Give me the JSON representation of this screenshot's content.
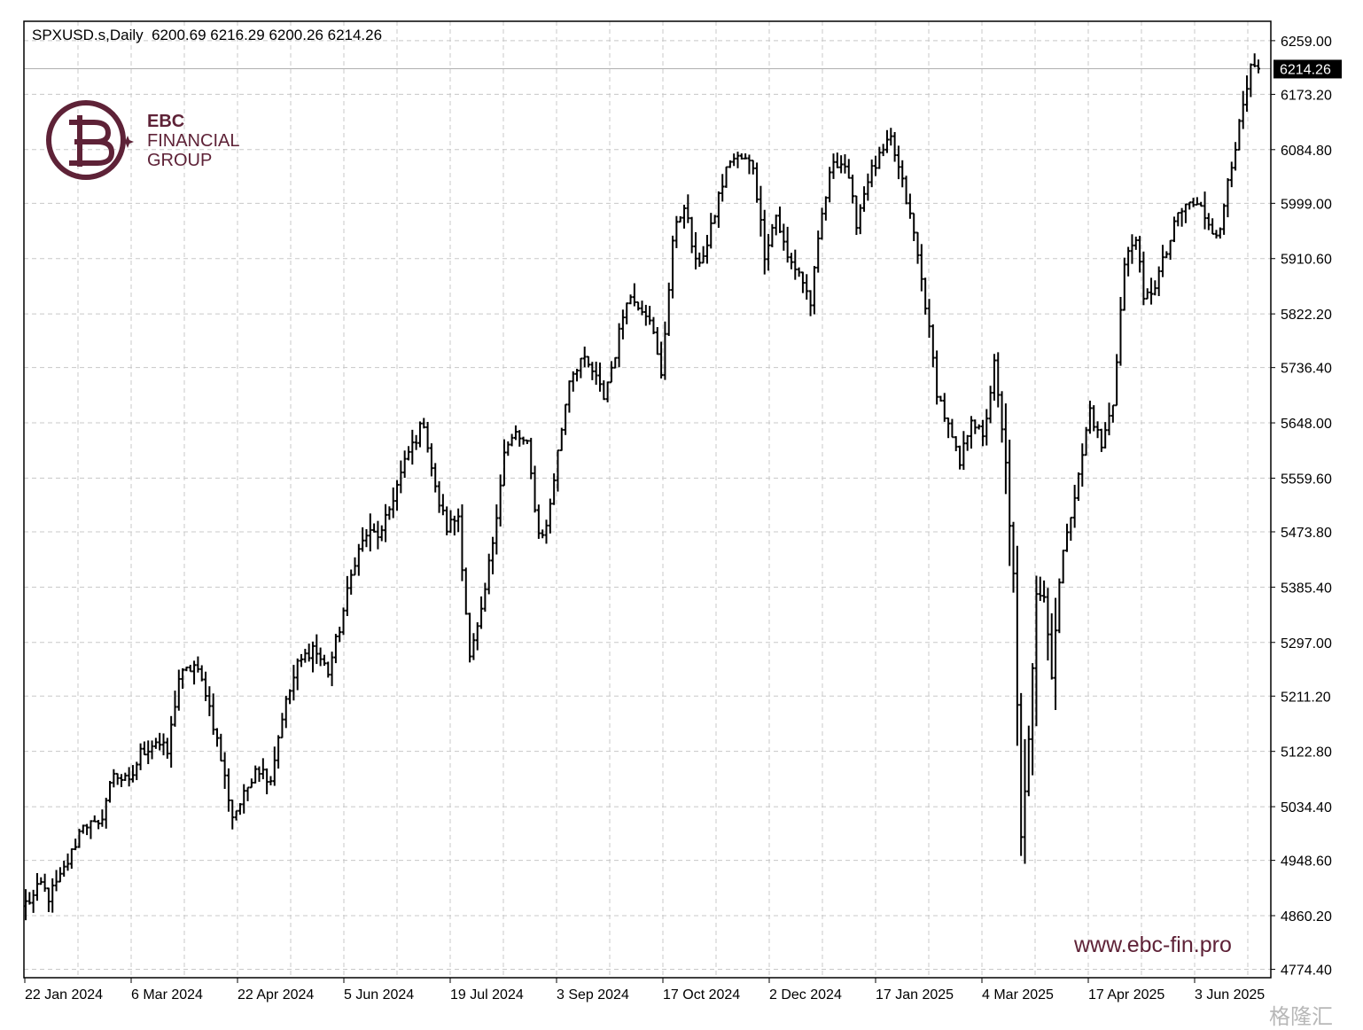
{
  "header": {
    "symbol": "SPXUSD.s,Daily",
    "ohlc": "6200.69 6216.29 6200.26 6214.26"
  },
  "brand": {
    "name_line1": "EBC",
    "name_line2": "FINANCIAL",
    "name_line3": "GROUP",
    "url": "www.ebc-fin.pro",
    "color": "#5e2237",
    "watermark": "格隆汇"
  },
  "chart_data": {
    "type": "bar",
    "subtype": "ohlc",
    "price_axis": {
      "position": "right",
      "ticks": [
        6259.0,
        6173.2,
        6084.8,
        5999.0,
        5910.6,
        5822.2,
        5736.4,
        5648.0,
        5559.6,
        5473.8,
        5385.4,
        5297.0,
        5211.2,
        5122.8,
        5034.4,
        4948.6,
        4860.2,
        4774.4
      ],
      "tick_labels": [
        "6259.00",
        "6173.20",
        "6084.80",
        "5999.00",
        "5910.60",
        "5822.20",
        "5736.40",
        "5648.00",
        "5559.60",
        "5473.80",
        "5385.40",
        "5297.00",
        "5211.20",
        "5122.80",
        "5034.40",
        "4948.60",
        "4860.20",
        "4774.40"
      ],
      "range": [
        4761,
        6290
      ]
    },
    "time_axis": {
      "labels": [
        "22 Jan 2024",
        "6 Mar 2024",
        "22 Apr 2024",
        "5 Jun 2024",
        "19 Jul 2024",
        "3 Sep 2024",
        "17 Oct 2024",
        "2 Dec 2024",
        "17 Jan 2025",
        "4 Mar 2025",
        "17 Apr 2025",
        "3 Jun 2025"
      ]
    },
    "current_price": 6214.26,
    "current_price_label": "6214.26",
    "grid": true,
    "bar_color": "#000000",
    "anchors": [
      [
        0,
        4880
      ],
      [
        2,
        4890
      ],
      [
        4,
        4910
      ],
      [
        6,
        4890
      ],
      [
        9,
        4920
      ],
      [
        12,
        4960
      ],
      [
        15,
        5010
      ],
      [
        19,
        5000
      ],
      [
        23,
        5090
      ],
      [
        27,
        5070
      ],
      [
        30,
        5120
      ],
      [
        34,
        5140
      ],
      [
        37,
        5120
      ],
      [
        40,
        5240
      ],
      [
        44,
        5260
      ],
      [
        47,
        5220
      ],
      [
        50,
        5140
      ],
      [
        54,
        5020
      ],
      [
        57,
        5050
      ],
      [
        60,
        5100
      ],
      [
        64,
        5080
      ],
      [
        67,
        5180
      ],
      [
        71,
        5260
      ],
      [
        75,
        5290
      ],
      [
        79,
        5250
      ],
      [
        82,
        5320
      ],
      [
        86,
        5430
      ],
      [
        89,
        5470
      ],
      [
        93,
        5470
      ],
      [
        96,
        5530
      ],
      [
        100,
        5600
      ],
      [
        104,
        5650
      ],
      [
        107,
        5540
      ],
      [
        110,
        5480
      ],
      [
        113,
        5500
      ],
      [
        116,
        5270
      ],
      [
        119,
        5340
      ],
      [
        122,
        5460
      ],
      [
        125,
        5600
      ],
      [
        128,
        5630
      ],
      [
        131,
        5610
      ],
      [
        134,
        5470
      ],
      [
        136,
        5480
      ],
      [
        139,
        5600
      ],
      [
        142,
        5720
      ],
      [
        145,
        5750
      ],
      [
        148,
        5730
      ],
      [
        151,
        5690
      ],
      [
        154,
        5760
      ],
      [
        157,
        5850
      ],
      [
        160,
        5840
      ],
      [
        163,
        5820
      ],
      [
        166,
        5720
      ],
      [
        169,
        5940
      ],
      [
        172,
        6000
      ],
      [
        175,
        5900
      ],
      [
        178,
        5930
      ],
      [
        181,
        6010
      ],
      [
        184,
        6070
      ],
      [
        187,
        6070
      ],
      [
        190,
        6060
      ],
      [
        193,
        5920
      ],
      [
        196,
        5980
      ],
      [
        199,
        5910
      ],
      [
        202,
        5890
      ],
      [
        205,
        5840
      ],
      [
        208,
        5980
      ],
      [
        211,
        6070
      ],
      [
        214,
        6060
      ],
      [
        217,
        5970
      ],
      [
        220,
        6040
      ],
      [
        223,
        6070
      ],
      [
        226,
        6100
      ],
      [
        229,
        6030
      ],
      [
        232,
        5950
      ],
      [
        235,
        5840
      ],
      [
        238,
        5700
      ],
      [
        241,
        5640
      ],
      [
        244,
        5580
      ],
      [
        247,
        5660
      ],
      [
        250,
        5620
      ],
      [
        253,
        5740
      ],
      [
        256,
        5580
      ],
      [
        258,
        5400
      ],
      [
        260,
        4980
      ],
      [
        262,
        5150
      ],
      [
        264,
        5380
      ],
      [
        266,
        5370
      ],
      [
        268,
        5250
      ],
      [
        270,
        5390
      ],
      [
        272,
        5480
      ],
      [
        275,
        5560
      ],
      [
        278,
        5670
      ],
      [
        281,
        5610
      ],
      [
        284,
        5680
      ],
      [
        287,
        5900
      ],
      [
        290,
        5950
      ],
      [
        292,
        5840
      ],
      [
        295,
        5870
      ],
      [
        298,
        5920
      ],
      [
        301,
        5980
      ],
      [
        304,
        6000
      ],
      [
        307,
        5990
      ],
      [
        310,
        5960
      ],
      [
        312,
        5950
      ],
      [
        314,
        6040
      ],
      [
        317,
        6120
      ],
      [
        320,
        6210
      ],
      [
        322,
        6214.26
      ]
    ],
    "bar_count": 323
  }
}
